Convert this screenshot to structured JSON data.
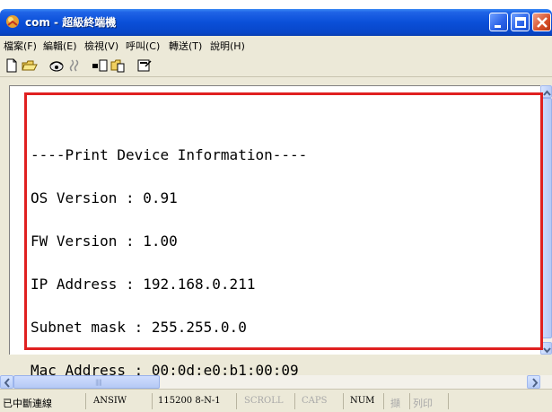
{
  "window": {
    "title": "com - 超級終端機",
    "app_icon": "hyperterminal-icon"
  },
  "menu": {
    "items": [
      {
        "label": "檔案(F)"
      },
      {
        "label": "編輯(E)"
      },
      {
        "label": "檢視(V)"
      },
      {
        "label": "呼叫(C)"
      },
      {
        "label": "轉送(T)"
      },
      {
        "label": "說明(H)"
      }
    ]
  },
  "toolbar": {
    "buttons": [
      {
        "icon": "new-file-icon"
      },
      {
        "icon": "open-folder-icon"
      },
      {
        "icon": "connect-icon"
      },
      {
        "icon": "disconnect-icon"
      },
      {
        "icon": "send-icon"
      },
      {
        "icon": "receive-icon"
      },
      {
        "icon": "properties-icon"
      }
    ]
  },
  "terminal": {
    "lines": [
      "----Print Device Information----",
      "OS Version : 0.91",
      "FW Version : 1.00",
      "IP Address : 192.168.0.211",
      "Subnet mask : 255.255.0.0",
      "Mac Address : 00:0d:e0:b1:00:09"
    ],
    "highlight_color": "#e02020"
  },
  "status": {
    "connection": "已中斷連線",
    "emulation": "ANSIW",
    "port_settings": "115200 8-N-1",
    "scroll": "SCROLL",
    "caps": "CAPS",
    "num": "NUM",
    "capture": "擷",
    "print": "列印"
  }
}
